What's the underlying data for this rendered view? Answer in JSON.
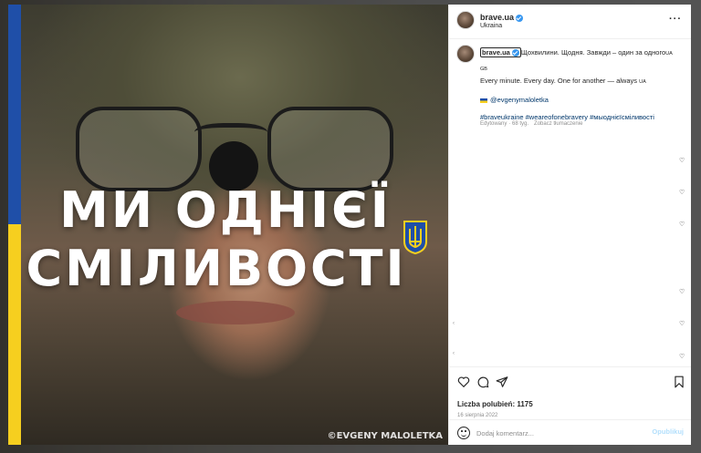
{
  "post": {
    "headline_line1": "МИ ОДНІЄЇ",
    "headline_line2": "СМІЛИВОСТІ",
    "photo_credit": "©EVGENY MALOLETKA"
  },
  "header": {
    "username": "brave.ua",
    "location": "Ukraina",
    "more_icon": "more-horizontal-icon"
  },
  "caption": {
    "username": "brave.ua",
    "text_ua": "Щохвилини. Щодня. Завжди – один за одного",
    "ua_suffix": "UA",
    "gb_label": "GB",
    "text_en": "Every minute. Every day. One for another — always",
    "en_suffix": "UA",
    "mention": "@evgenymaloletka",
    "hashtags": "#braveukraine #weareofonebravery #мыоднієїсміливості",
    "edited": "Edytowany",
    "time_ago": "· 68 tyg.",
    "translate": "Zobacz tłumaczenie"
  },
  "actions": {
    "likes": "Liczba polubień: 1175",
    "date": "16 sierpnia 2022"
  },
  "comment": {
    "placeholder": "Dodaj komentarz...",
    "post_label": "Opublikuj"
  },
  "colors": {
    "ukraine_blue": "#1f4fa8",
    "ukraine_yellow": "#f6cf1f",
    "link": "#00376b",
    "verified": "#3897f0"
  }
}
